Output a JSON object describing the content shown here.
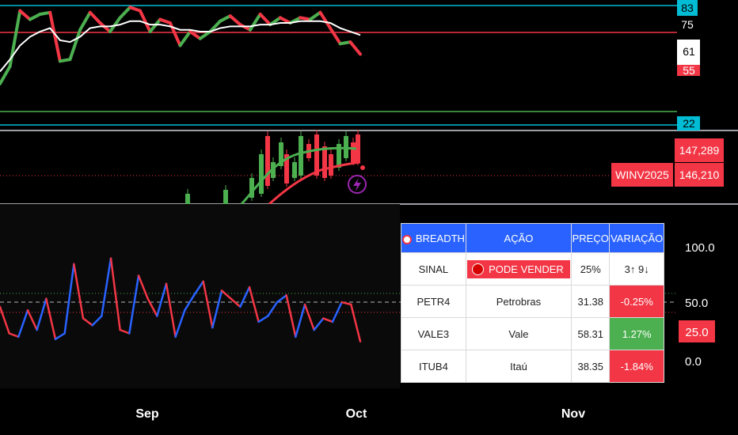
{
  "colors": {
    "up": "#4caf50",
    "down": "#f23645",
    "blue": "#2962ff",
    "cyan": "#00bcd4",
    "bg": "#000000"
  },
  "rsi_panel": {
    "label_83": "83",
    "label_75": "75",
    "label_61": "61",
    "label_55": "55",
    "label_22": "22"
  },
  "price_panel": {
    "last_price": "147,289",
    "symbol": "WINV2025",
    "mark_price": "146,210",
    "lightning_icon": "lightning-icon"
  },
  "breadth_panel": {
    "axis_100": "100.0",
    "axis_50": "50.0",
    "axis_25": "25.0",
    "axis_0": "0.0"
  },
  "table": {
    "headers": [
      "BREADTH",
      "AÇÃO",
      "PREÇO",
      "VARIAÇÃO"
    ],
    "signal_row": {
      "label": "SINAL",
      "signal": "PODE VENDER",
      "pct": "25%",
      "counts": "3↑ 9↓"
    },
    "rows": [
      {
        "ticker": "PETR4",
        "name": "Petrobras",
        "price": "31.38",
        "change": "-0.25%",
        "dir": "down"
      },
      {
        "ticker": "VALE3",
        "name": "Vale",
        "price": "58.31",
        "change": "1.27%",
        "dir": "up"
      },
      {
        "ticker": "ITUB4",
        "name": "Itaú",
        "price": "38.35",
        "change": "-1.84%",
        "dir": "down"
      }
    ]
  },
  "x_axis": {
    "sep": "Sep",
    "oct": "Oct",
    "nov": "Nov"
  },
  "chart_data": [
    {
      "type": "line",
      "series": [
        {
          "values": [
            38,
            48,
            80,
            75,
            78,
            79,
            51,
            52,
            69,
            79,
            73,
            68,
            76,
            82,
            80,
            68,
            75,
            73,
            60,
            68,
            64,
            68,
            74,
            77,
            72,
            69,
            78,
            72,
            76,
            73,
            76,
            75,
            79,
            70,
            61,
            62,
            55
          ],
          "color_by_trend": true
        },
        {
          "values": [
            45,
            52,
            60,
            65,
            68,
            70,
            63,
            62,
            65,
            70,
            71,
            71,
            72,
            74,
            74,
            72,
            72,
            71,
            69,
            69,
            68,
            68,
            70,
            71,
            71,
            71,
            72,
            72,
            73,
            73,
            74,
            74,
            74,
            73,
            70,
            68,
            66
          ],
          "color": "#ffffff"
        }
      ],
      "hlines": [
        83,
        75,
        22
      ]
    },
    {
      "type": "bar",
      "candles": [
        [
          0,
          0.0
        ],
        [
          1,
          0.1
        ],
        [
          2,
          0.6
        ],
        [
          3,
          0.7
        ],
        [
          4,
          0.8
        ],
        [
          5,
          0.85
        ],
        [
          6,
          0.7
        ],
        [
          7,
          0.9
        ],
        [
          8,
          0.95
        ],
        [
          9,
          1.0
        ],
        [
          10,
          0.9
        ],
        [
          11,
          0.95
        ],
        [
          12,
          0.85
        ],
        [
          13,
          0.9
        ],
        [
          14,
          0.8
        ]
      ]
    },
    {
      "type": "line",
      "y_range": [
        0,
        100
      ],
      "values": [
        48,
        25,
        22,
        45,
        28,
        55,
        20,
        25,
        85,
        38,
        32,
        40,
        90,
        28,
        25,
        75,
        55,
        40,
        68,
        22,
        45,
        58,
        70,
        30,
        62,
        55,
        48,
        65,
        35,
        40,
        52,
        58,
        22,
        50,
        28,
        38,
        35,
        52,
        50,
        18
      ],
      "hlines": [
        50,
        25
      ]
    }
  ]
}
